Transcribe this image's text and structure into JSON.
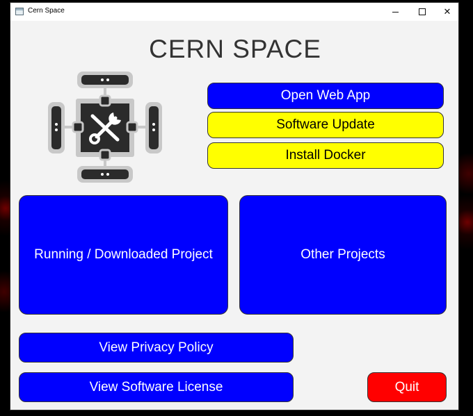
{
  "window": {
    "title": "Cern Space",
    "controls": {
      "minimize": "minimize",
      "maximize": "maximize",
      "close": "✕"
    }
  },
  "header": {
    "title": "CERN SPACE"
  },
  "logo": {
    "icon": "tools-hub-icon"
  },
  "actions": {
    "open_web_app": "Open Web App",
    "software_update": "Software Update",
    "install_docker": "Install Docker"
  },
  "projects": {
    "running": "Running / Downloaded Project",
    "other": "Other Projects"
  },
  "footer": {
    "privacy": "View Privacy Policy",
    "license": "View Software License",
    "quit": "Quit"
  },
  "colors": {
    "primary_button": "#0000ff",
    "secondary_button": "#ffff00",
    "danger_button": "#ff0000",
    "window_background": "#f3f3f3"
  }
}
